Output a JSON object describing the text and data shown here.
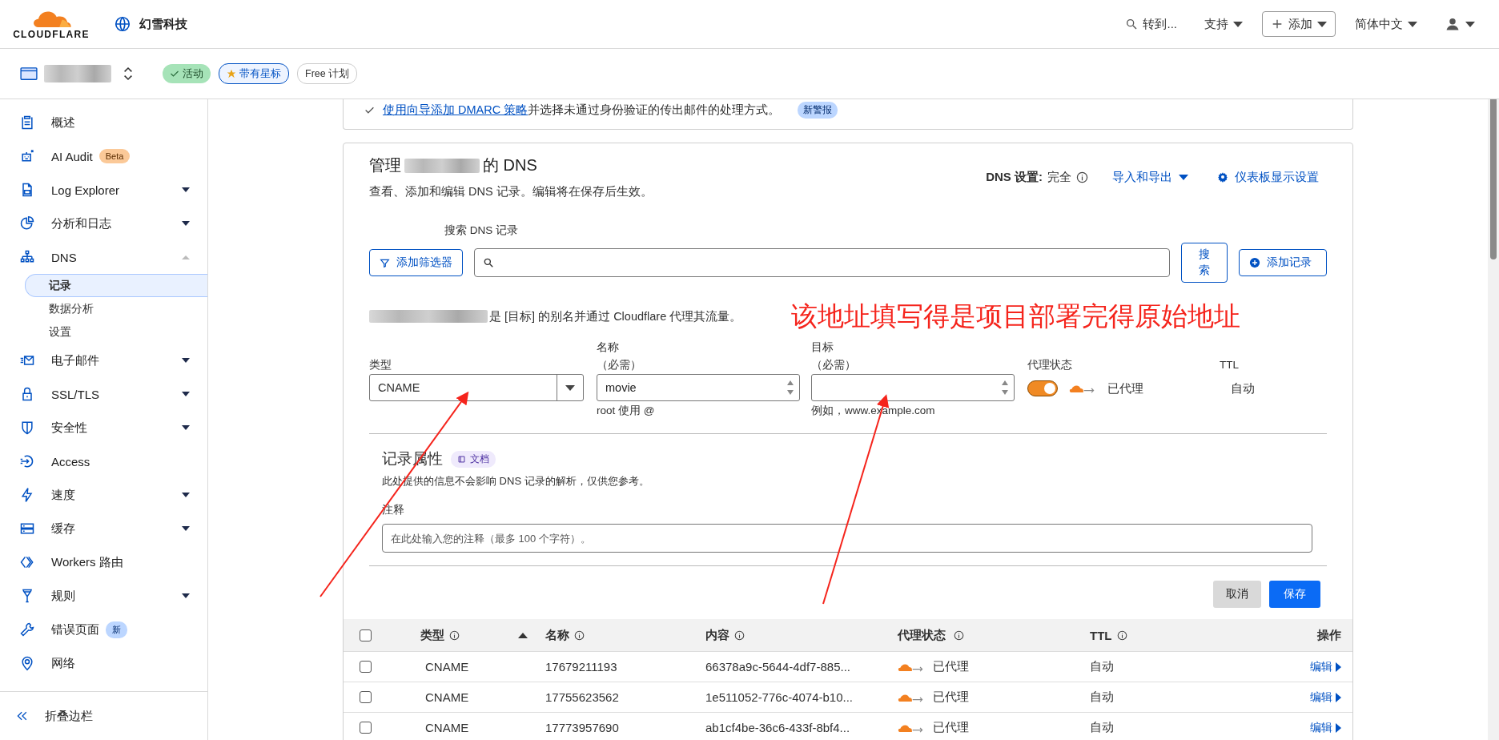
{
  "header": {
    "brand": "CLOUDFLARE",
    "account": "幻雪科技",
    "goto": "转到...",
    "support": "支持",
    "add": "添加",
    "language": "简体中文"
  },
  "zone_bar": {
    "badges": [
      {
        "label": "活动",
        "kind": "active"
      },
      {
        "label": "带有星标",
        "kind": "starred"
      },
      {
        "label": "Free 计划",
        "kind": "plan"
      }
    ]
  },
  "sidebar": {
    "items": [
      {
        "label": "概述",
        "kind": "link"
      },
      {
        "label": "AI Audit",
        "kind": "link",
        "badge": {
          "text": "Beta",
          "kind": "beta"
        }
      },
      {
        "label": "Log Explorer",
        "kind": "menu",
        "expanded": false
      },
      {
        "label": "分析和日志",
        "kind": "menu",
        "expanded": false
      },
      {
        "label": "DNS",
        "kind": "menu",
        "expanded": true,
        "children": [
          {
            "label": "记录",
            "selected": true
          },
          {
            "label": "数据分析",
            "selected": false
          },
          {
            "label": "设置",
            "selected": false
          }
        ]
      },
      {
        "label": "电子邮件",
        "kind": "menu",
        "expanded": false
      },
      {
        "label": "SSL/TLS",
        "kind": "menu",
        "expanded": false
      },
      {
        "label": "安全性",
        "kind": "menu",
        "expanded": false
      },
      {
        "label": "Access",
        "kind": "link"
      },
      {
        "label": "速度",
        "kind": "menu",
        "expanded": false
      },
      {
        "label": "缓存",
        "kind": "menu",
        "expanded": false
      },
      {
        "label": "Workers 路由",
        "kind": "link"
      },
      {
        "label": "规则",
        "kind": "menu",
        "expanded": false
      },
      {
        "label": "错误页面",
        "kind": "link",
        "badge": {
          "text": "新",
          "kind": "new"
        }
      },
      {
        "label": "网络",
        "kind": "link"
      }
    ],
    "collapse": "折叠边栏"
  },
  "alert": {
    "link": "使用向导添加 DMARC 策略",
    "text": "并选择未通过身份验证的传出邮件的处理方式。",
    "badge": "新警报"
  },
  "dns": {
    "title_prefix": "管理",
    "title_suffix": "的 DNS",
    "subtitle": "查看、添加和编辑 DNS 记录。编辑将在保存后生效。",
    "setting_label": "DNS 设置:",
    "setting_value": "完全",
    "import_export": "导入和导出",
    "display_settings": "仪表板显示设置",
    "search_label": "搜索 DNS 记录",
    "filter_button": "添加筛选器",
    "search_button": "搜索",
    "add_button": "添加记录"
  },
  "form": {
    "alias_text": "是 [目标] 的别名并通过 Cloudflare 代理其流量。",
    "annotation": "该地址填写得是项目部署完得原始地址",
    "type": {
      "label": "类型",
      "value": "CNAME"
    },
    "name": {
      "label": "名称",
      "required": "（必需）",
      "value": "movie",
      "hint": "root 使用 @"
    },
    "target": {
      "label": "目标",
      "required": "（必需）",
      "hint": "例如，www.example.com"
    },
    "proxy": {
      "label": "代理状态",
      "on": true,
      "text": "已代理"
    },
    "ttl": {
      "label": "TTL",
      "value": "自动"
    },
    "attributes": {
      "title": "记录属性",
      "doc": "文档",
      "description": "此处提供的信息不会影响 DNS 记录的解析，仅供您参考。",
      "comment_label": "注释",
      "comment_placeholder": "在此处输入您的注释（最多 100 个字符）。"
    },
    "cancel": "取消",
    "save": "保存"
  },
  "table": {
    "all_checked": false,
    "columns": [
      {
        "label": "类型",
        "info": true,
        "sorted": true
      },
      {
        "label": "名称",
        "info": true,
        "sorted": false
      },
      {
        "label": "内容",
        "info": true,
        "sorted": false
      },
      {
        "label": "代理状态",
        "info": true,
        "sorted": false
      },
      {
        "label": "TTL",
        "info": true,
        "sorted": false
      },
      {
        "label": "操作",
        "info": false,
        "sorted": false
      }
    ],
    "rows": [
      {
        "checked": false,
        "type": "CNAME",
        "name": "17679211193",
        "content": "66378a9c-5644-4df7-885...",
        "proxied": true,
        "proxy": "已代理",
        "ttl": "自动",
        "action": "编辑"
      },
      {
        "checked": false,
        "type": "CNAME",
        "name": "17755623562",
        "content": "1e511052-776c-4074-b10...",
        "proxied": true,
        "proxy": "已代理",
        "ttl": "自动",
        "action": "编辑"
      },
      {
        "checked": false,
        "type": "CNAME",
        "name": "17773957690",
        "content": "ab1cf4be-36c6-433f-8bf4...",
        "proxied": true,
        "proxy": "已代理",
        "ttl": "自动",
        "action": "编辑"
      }
    ]
  }
}
